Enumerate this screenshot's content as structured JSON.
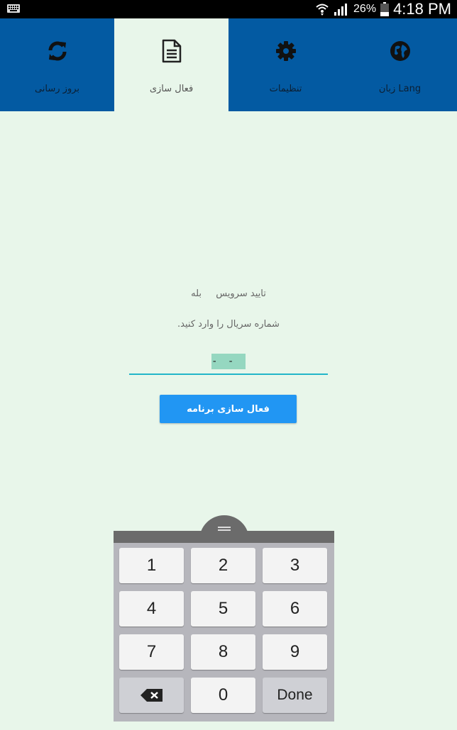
{
  "status_bar": {
    "battery": "26%",
    "time": "4:18 PM"
  },
  "tabs": [
    {
      "label": "بروز رسانی",
      "icon": "refresh-icon"
    },
    {
      "label": "فعال سازی",
      "icon": "document-icon",
      "active": true
    },
    {
      "label": "تنظیمات",
      "icon": "gear-icon"
    },
    {
      "label": "زبان Lang",
      "icon": "globe-icon"
    }
  ],
  "content": {
    "service_label": "تایید سرویس",
    "service_value": "بله",
    "hint": "شماره سریال را وارد کنید.",
    "serial_value": "- - -",
    "activate_label": "فعال سازی برنامه"
  },
  "keyboard": {
    "keys": [
      "1",
      "2",
      "3",
      "4",
      "5",
      "6",
      "7",
      "8",
      "9",
      "0"
    ],
    "done_label": "Done",
    "backspace_icon": "backspace-icon"
  },
  "colors": {
    "tab_bg": "#035aa2",
    "page_bg": "#e8f6ea",
    "button": "#2196f3",
    "underline": "#22b5c9"
  }
}
